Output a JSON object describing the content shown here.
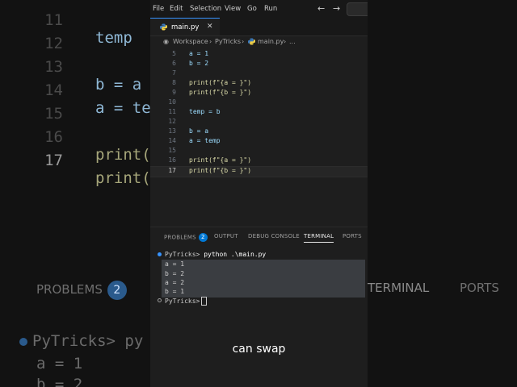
{
  "background": {
    "code_lines": [
      {
        "ln": "11",
        "text": "temp",
        "active": false
      },
      {
        "ln": "12",
        "text": "",
        "active": false
      },
      {
        "ln": "13",
        "text": "b = a",
        "active": false
      },
      {
        "ln": "14",
        "text": "a = temp",
        "active": false
      },
      {
        "ln": "15",
        "text": "",
        "active": false
      },
      {
        "ln": "16",
        "text": "print(",
        "active": false
      },
      {
        "ln": "17",
        "text": "print(",
        "active": true
      }
    ],
    "tabs": {
      "problems": "PROBLEMS",
      "problems_count": "2",
      "terminal": "TERMINAL",
      "ports": "PORTS"
    },
    "terminal_prompt": "PyTricks> py",
    "terminal_lines": [
      "a = 1",
      "b = 2"
    ]
  },
  "menubar": {
    "items": [
      "File",
      "Edit",
      "Selection",
      "View",
      "Go",
      "Run"
    ],
    "back_icon": "arrow-left",
    "forward_icon": "arrow-right"
  },
  "editor_tab": {
    "label": "main.py",
    "close": "✕"
  },
  "breadcrumb": {
    "items": [
      "Workspace",
      "PyTricks",
      "main.py",
      "..."
    ],
    "separator": "›"
  },
  "code": {
    "lines": [
      {
        "ln": "5",
        "text": "a = 1"
      },
      {
        "ln": "6",
        "text": "b = 2"
      },
      {
        "ln": "7",
        "text": ""
      },
      {
        "ln": "8",
        "text": "print(f\"{a = }\")"
      },
      {
        "ln": "9",
        "text": "print(f\"{b = }\")"
      },
      {
        "ln": "10",
        "text": ""
      },
      {
        "ln": "11",
        "text": "temp = b"
      },
      {
        "ln": "12",
        "text": ""
      },
      {
        "ln": "13",
        "text": "b = a"
      },
      {
        "ln": "14",
        "text": "a = temp"
      },
      {
        "ln": "15",
        "text": ""
      },
      {
        "ln": "16",
        "text": "print(f\"{a = }\")"
      },
      {
        "ln": "17",
        "text": "print(f\"{b = }\")"
      }
    ],
    "current_line": "17"
  },
  "panel": {
    "tabs": [
      "PROBLEMS",
      "OUTPUT",
      "DEBUG CONSOLE",
      "TERMINAL",
      "PORTS"
    ],
    "problems_count": "2",
    "active_tab": "TERMINAL"
  },
  "terminal": {
    "prompt": "PyTricks>",
    "command": "python .\\main.py",
    "output": [
      "a = 1",
      "b = 2",
      "a = 2",
      "b = 1"
    ],
    "second_prompt": "PyTricks>"
  },
  "caption": "can swap",
  "colors": {
    "accent": "#0078d4",
    "background": "#1e1e1e",
    "dot_blue": "#3794ff"
  }
}
